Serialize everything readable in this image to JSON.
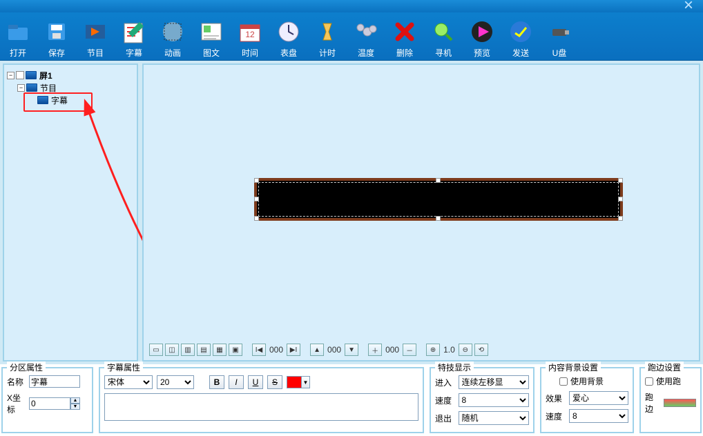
{
  "toolbar": {
    "items": [
      {
        "label": "打开",
        "icon": "open"
      },
      {
        "label": "保存",
        "icon": "save"
      },
      {
        "label": "节目",
        "icon": "program"
      },
      {
        "label": "字幕",
        "icon": "subtitle"
      },
      {
        "label": "动画",
        "icon": "anim"
      },
      {
        "label": "图文",
        "icon": "imgtext"
      },
      {
        "label": "时间",
        "icon": "time"
      },
      {
        "label": "表盘",
        "icon": "clock"
      },
      {
        "label": "计时",
        "icon": "timer"
      },
      {
        "label": "温度",
        "icon": "temp"
      },
      {
        "label": "删除",
        "icon": "delete"
      },
      {
        "label": "寻机",
        "icon": "search"
      },
      {
        "label": "预览",
        "icon": "preview"
      },
      {
        "label": "发送",
        "icon": "send"
      },
      {
        "label": "U盘",
        "icon": "usb"
      }
    ]
  },
  "tree": {
    "screen": "屏1",
    "program": "节目",
    "subtitle": "字幕"
  },
  "canvas_footer": {
    "page_num": "000",
    "count_num": "000",
    "zoom": "1.0"
  },
  "props": {
    "region": {
      "legend": "分区属性",
      "name_label": "名称",
      "name_value": "字幕",
      "x_label": "X坐标",
      "x_value": "0"
    },
    "subtitle": {
      "legend": "字幕属性",
      "font": "宋体",
      "size": "20",
      "btn_b": "B",
      "btn_i": "I",
      "btn_u": "U",
      "btn_s": "S"
    },
    "effect": {
      "legend": "特技显示",
      "enter_label": "进入",
      "enter_value": "连续左移显",
      "speed_label": "速度",
      "speed_value": "8",
      "exit_label": "退出",
      "exit_value": "随机"
    },
    "bg": {
      "legend": "内容背景设置",
      "use_bg": "使用背景",
      "effect_label": "效果",
      "effect_value": "爱心",
      "speed_label": "速度",
      "speed_value": "8"
    },
    "border": {
      "legend": "跑边设置",
      "use_border": "使用跑",
      "edge_label": "跑边"
    }
  }
}
